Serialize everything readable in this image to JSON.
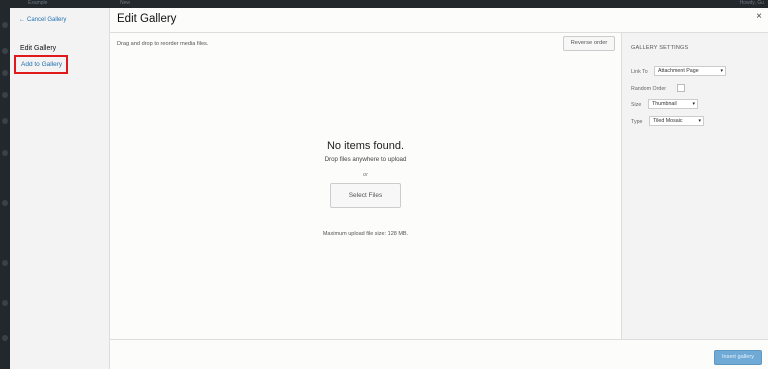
{
  "admin": {
    "topbar_site": "Example",
    "topbar_new": "New",
    "topbar_user": "Howdy, Gu"
  },
  "menu": {
    "cancel_icon": "left-arrow-icon",
    "cancel_label": "Cancel Gallery",
    "edit_gallery_label": "Edit Gallery",
    "add_to_gallery_label": "Add to Gallery",
    "highlight_color": "#e0191b"
  },
  "header": {
    "title": "Edit Gallery",
    "close_icon": "close-icon",
    "close_glyph": "×"
  },
  "toolbar": {
    "hint": "Drag and drop to reorder media files.",
    "reverse_order_label": "Reverse order"
  },
  "uploader": {
    "empty_title": "No items found.",
    "drop_text": "Drop files anywhere to upload",
    "or_text": "or",
    "select_files_label": "Select Files",
    "max_size_text": "Maximum upload file size: 128 MB."
  },
  "settings": {
    "title": "GALLERY SETTINGS",
    "link_to_label": "Link To",
    "link_to_value": "Attachment Page",
    "random_order_label": "Random Order",
    "size_label": "Size",
    "size_value": "Thumbnail",
    "type_label": "Type",
    "type_value": "Tiled Mosaic",
    "caret_glyph": "▾"
  },
  "footer": {
    "insert_label": "Insert gallery",
    "accent_color": "#6fa9d6"
  }
}
